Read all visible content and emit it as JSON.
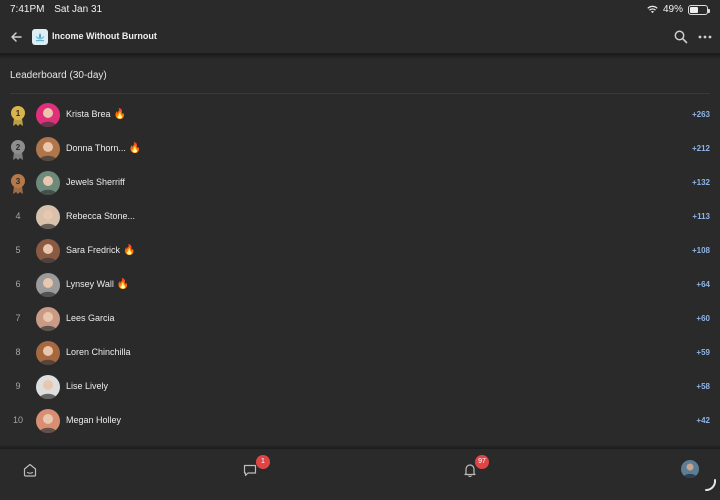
{
  "status": {
    "time": "7:41PM",
    "date": "Sat Jan 31",
    "battery": "49%",
    "battery_level": 0.49
  },
  "header": {
    "title": "Income Without Burnout",
    "back_icon": "back-arrow-icon",
    "search_icon": "search-icon",
    "more_icon": "more-icon"
  },
  "leaderboard": {
    "title": "Leaderboard (30-day)",
    "rows": [
      {
        "rank": "1",
        "name": "Krista Brea",
        "fire": true,
        "points": "+263",
        "avatar_color": "#e0307a",
        "medal": "gold"
      },
      {
        "rank": "2",
        "name": "Donna Thorn...",
        "fire": true,
        "points": "+212",
        "avatar_color": "#b0764a",
        "medal": "silver"
      },
      {
        "rank": "3",
        "name": "Jewels Sherriff",
        "fire": false,
        "points": "+132",
        "avatar_color": "#6d8a7c",
        "medal": "bronze"
      },
      {
        "rank": "4",
        "name": "Rebecca Stone...",
        "fire": false,
        "points": "+113",
        "avatar_color": "#d9c2ad",
        "medal": ""
      },
      {
        "rank": "5",
        "name": "Sara Fredrick",
        "fire": true,
        "points": "+108",
        "avatar_color": "#8a5a43",
        "medal": ""
      },
      {
        "rank": "6",
        "name": "Lynsey Wall",
        "fire": true,
        "points": "+64",
        "avatar_color": "#9b9b9b",
        "medal": ""
      },
      {
        "rank": "7",
        "name": "Lees Garcia",
        "fire": false,
        "points": "+60",
        "avatar_color": "#c99a86",
        "medal": ""
      },
      {
        "rank": "8",
        "name": "Loren Chinchilla",
        "fire": false,
        "points": "+59",
        "avatar_color": "#a5683f",
        "medal": ""
      },
      {
        "rank": "9",
        "name": "Lise Lively",
        "fire": false,
        "points": "+58",
        "avatar_color": "#dedede",
        "medal": ""
      },
      {
        "rank": "10",
        "name": "Megan Holley",
        "fire": false,
        "points": "+42",
        "avatar_color": "#d88e73",
        "medal": ""
      }
    ]
  },
  "tabs": {
    "chat_badge": "1",
    "notifications_badge": "97"
  },
  "colors": {
    "background": "#2a2a2a",
    "points": "#8fb4e6",
    "badge": "#e04545",
    "gold": "#d8b44a",
    "silver": "#8e8e8e",
    "bronze": "#b5784a"
  }
}
